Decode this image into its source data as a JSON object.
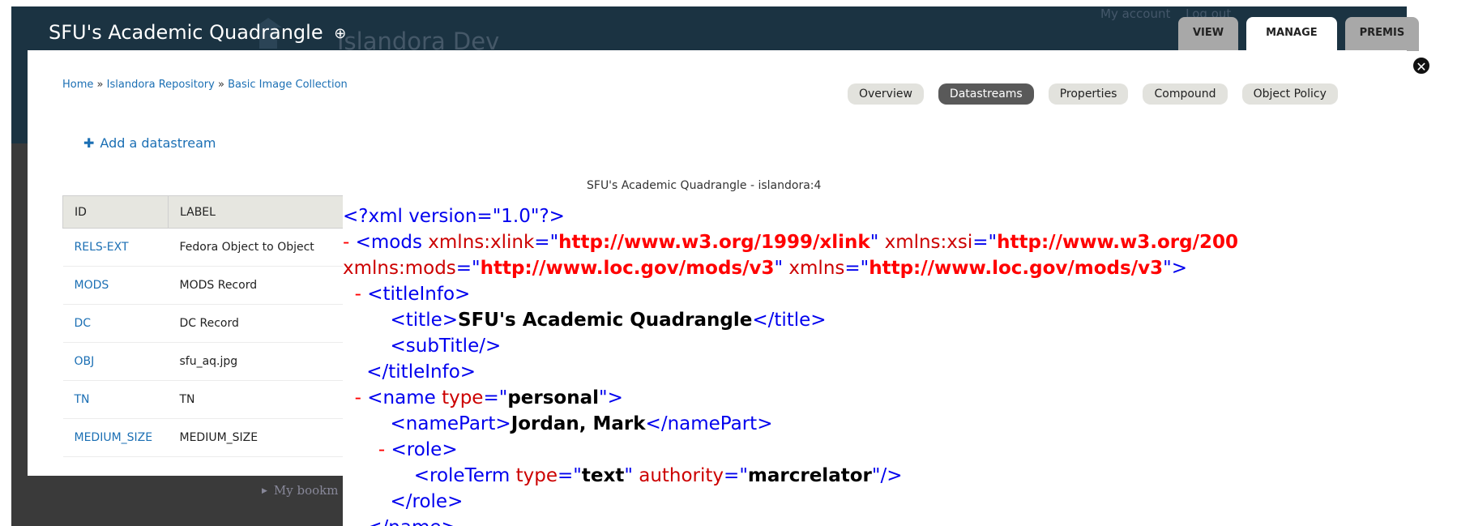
{
  "site": {
    "name": "SFU's Academic Quadrangle",
    "background_site_name": "Islandora Dev",
    "user_links": [
      "My account",
      "Log out"
    ]
  },
  "primary_tabs": [
    "VIEW",
    "MANAGE",
    "PREMIS"
  ],
  "breadcrumb": {
    "items": [
      "Home",
      "Islandora Repository",
      "Basic Image Collection"
    ],
    "separator": "»"
  },
  "secondary_tabs": [
    "Overview",
    "Datastreams",
    "Properties",
    "Compound",
    "Object Policy"
  ],
  "add_datastream": "Add a datastream",
  "table": {
    "headers": [
      "ID",
      "LABEL"
    ],
    "rows": [
      {
        "id": "RELS-EXT",
        "label": "Fedora Object to Object"
      },
      {
        "id": "MODS",
        "label": "MODS Record"
      },
      {
        "id": "DC",
        "label": "DC Record"
      },
      {
        "id": "OBJ",
        "label": "sfu_aq.jpg"
      },
      {
        "id": "TN",
        "label": "TN"
      },
      {
        "id": "MEDIUM_SIZE",
        "label": "MEDIUM_SIZE"
      }
    ]
  },
  "bookmarks_label": "My bookm",
  "xml_view": {
    "caption": "SFU's Academic Quadrangle - islandora:4",
    "declaration": "<?xml version=\"1.0\"?>",
    "xlink_ns": "http://www.w3.org/1999/xlink",
    "xsi_ns_partial": "http://www.w3.org/200",
    "mods_ns": "http://www.loc.gov/mods/v3",
    "default_ns": "http://www.loc.gov/mods/v3",
    "title": "SFU's Academic Quadrangle",
    "name_type": "personal",
    "name_part": "Jordan, Mark",
    "role_term_type": "text",
    "role_term_authority": "marcrelator"
  },
  "colors": {
    "header_bg": "#1b3342",
    "page_dark_bg": "#3a3a3a",
    "link": "#1b6fb4",
    "active_tab": "#595959",
    "xml_tag": "#0000ee",
    "xml_attr_name": "#cc0000",
    "xml_attr_value": "#ff0000"
  }
}
